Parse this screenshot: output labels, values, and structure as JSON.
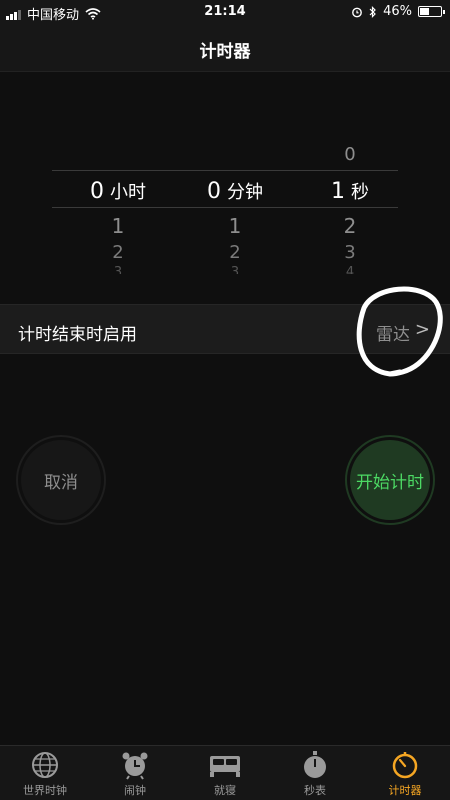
{
  "status_bar": {
    "carrier": "中国移动",
    "time": "21:14",
    "battery": "46%",
    "battery_level": 0.46,
    "icons": [
      "signal-icon",
      "wifi-icon",
      "alarm-icon",
      "bluetooth-icon",
      "battery-icon"
    ]
  },
  "nav": {
    "title": "计时器"
  },
  "picker": {
    "hours": {
      "above": "",
      "selected": "0",
      "below": [
        "1",
        "2",
        "3"
      ],
      "unit": "小时"
    },
    "minutes": {
      "above": "",
      "selected": "0",
      "below": [
        "1",
        "2",
        "3"
      ],
      "unit": "分钟"
    },
    "seconds": {
      "above": "0",
      "selected": "1",
      "below": [
        "2",
        "3",
        "4"
      ],
      "unit": "秒"
    }
  },
  "when_timer_ends": {
    "label": "计时结束时启用",
    "value": "雷达",
    "chevron": ">"
  },
  "buttons": {
    "cancel": "取消",
    "start": "开始计时"
  },
  "colors": {
    "accent": "#f5a623",
    "start_green": "#4cd964",
    "start_bg": "#1f3a22",
    "muted": "#8e8e8e"
  },
  "tabs": [
    {
      "label": "世界时钟",
      "icon": "globe-icon",
      "active": false
    },
    {
      "label": "闹钟",
      "icon": "alarm-clock-icon",
      "active": false
    },
    {
      "label": "就寝",
      "icon": "bed-icon",
      "active": false
    },
    {
      "label": "秒表",
      "icon": "stopwatch-icon",
      "active": false
    },
    {
      "label": "计时器",
      "icon": "timer-icon",
      "active": true
    }
  ]
}
